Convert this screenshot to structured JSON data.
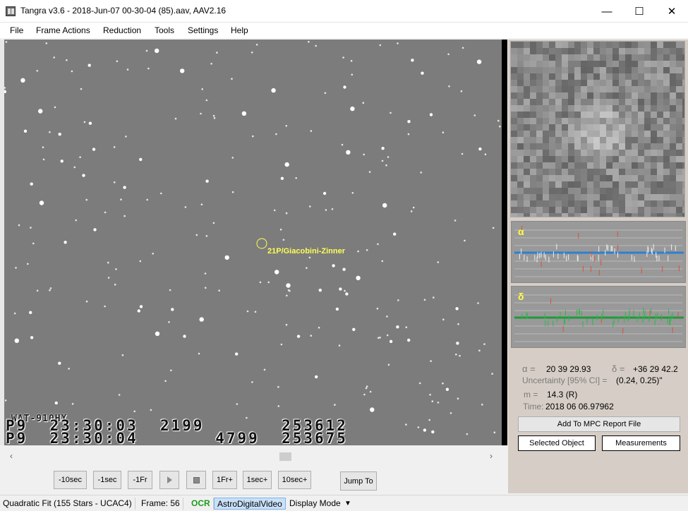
{
  "window": {
    "title": "Tangra v3.6 - 2018-Jun-07 00-30-04 (85).aav, AAV2.16",
    "minimize": "—",
    "maximize": "☐",
    "close": "✕"
  },
  "menu": [
    "File",
    "Frame Actions",
    "Reduction",
    "Tools",
    "Settings",
    "Help"
  ],
  "video": {
    "target_label": "21P/Giacobini-Zinner",
    "osd_camera": "WAT-910HX",
    "osd_line1": "P9  23:30:03  2199       253612",
    "osd_line2": "P9  23:30:04       4799  253675"
  },
  "controls": {
    "buttons": [
      "-10sec",
      "-1sec",
      "-1Fr",
      "1Fr+",
      "1sec+",
      "10sec+"
    ],
    "jump_to": "Jump To"
  },
  "plots": {
    "alpha_symbol": "α",
    "delta_symbol": "δ"
  },
  "astrometry": {
    "alpha_label": "α =",
    "alpha_value": "20 39 29.93",
    "delta_label": "δ =",
    "delta_value": "+36 29 42.2",
    "uncertainty_label": "Uncertainty [95% CI] =",
    "uncertainty_value": "(0.24, 0.25)\"",
    "mag_label": "m =",
    "mag_value": "14.3 (R)",
    "time_label": "Time:",
    "time_value": "2018 06 06.97962"
  },
  "panel_buttons": {
    "add_mpc": "Add To MPC Report File",
    "selected_object": "Selected Object",
    "measurements": "Measurements"
  },
  "status": {
    "fit": "Quadratic Fit (155 Stars - UCAC4)",
    "frame": "Frame: 56",
    "ocr": "OCR",
    "video_type": "AstroDigitalVideo",
    "display_mode": "Display Mode"
  },
  "colors": {
    "osd_ok": "#1a9c1a",
    "target": "#ffff55",
    "alpha_fit": "#2f7fd0",
    "delta_fit": "#1f9a3a",
    "outlier": "#e05030"
  }
}
